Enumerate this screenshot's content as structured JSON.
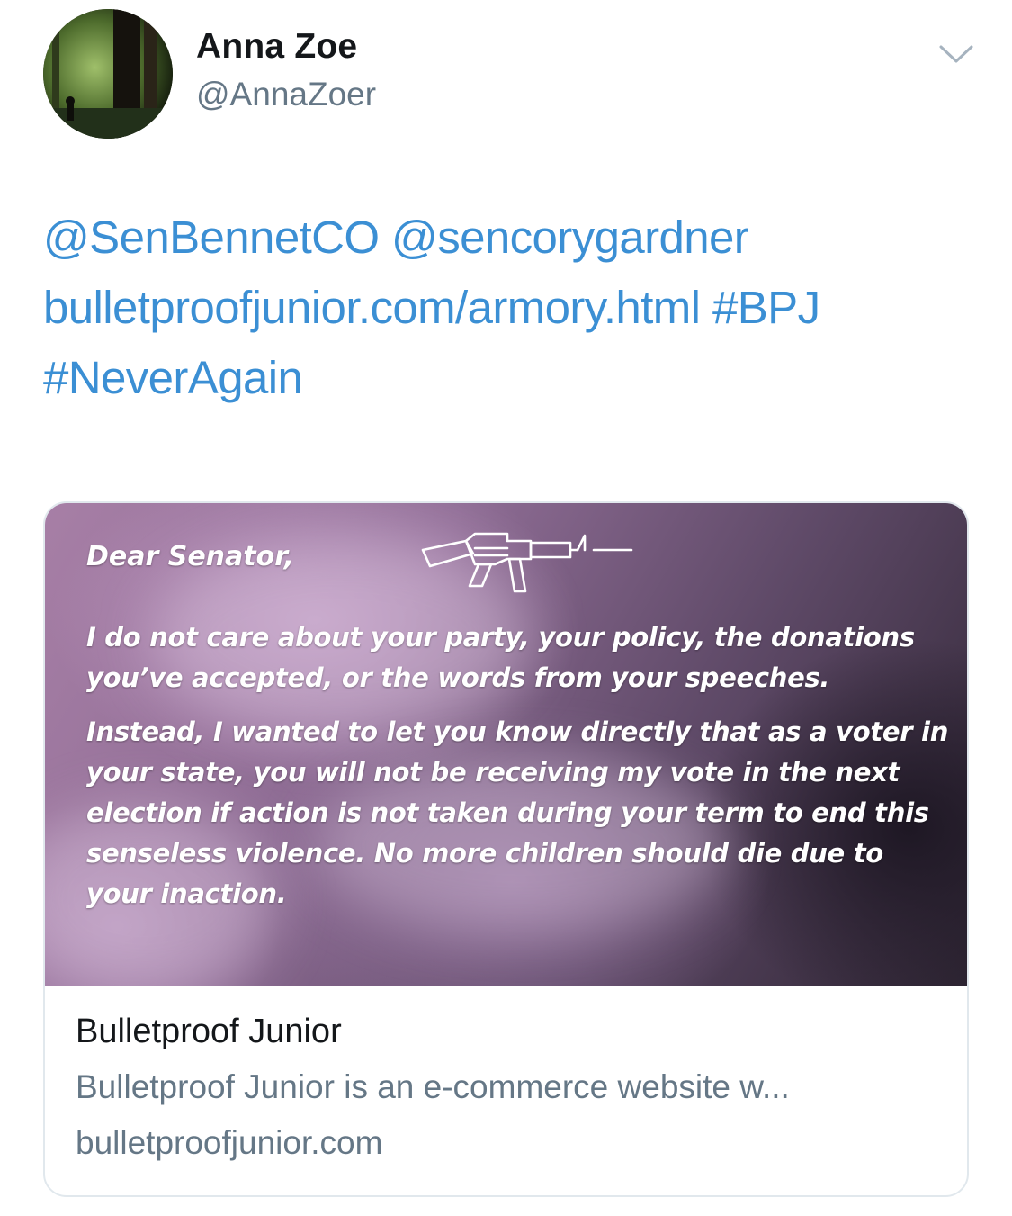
{
  "author": {
    "display_name": "Anna Zoe",
    "handle": "@AnnaZoer",
    "avatar_icon": "forest-photo-avatar"
  },
  "menu_icon": "chevron-down-icon",
  "tweet": {
    "mention_1": "@SenBennetCO",
    "mention_2": "@sencorygardner",
    "link": "bulletproofjunior.com/armory.html",
    "hashtag_1": "#BPJ",
    "hashtag_2": "#NeverAgain"
  },
  "card": {
    "image": {
      "greeting": "Dear Senator,",
      "paragraph_1": "I do not care about your party, your policy, the donations you’ve accepted, or the words from your speeches.",
      "paragraph_2": "Instead, I wanted to let you know directly that as a voter in your state, you will not be receiving my vote in the next election if action is not taken during your term to end this senseless violence. No more children should die due to your inaction.",
      "logo_icon": "rifle-outline-icon"
    },
    "title": "Bulletproof Junior",
    "description": "Bulletproof Junior is an e-commerce website w...",
    "domain": "bulletproofjunior.com"
  },
  "colors": {
    "link_blue": "#3b8fd4",
    "text_dark": "#14171a",
    "text_gray": "#657786",
    "border": "#e1e8ed"
  }
}
